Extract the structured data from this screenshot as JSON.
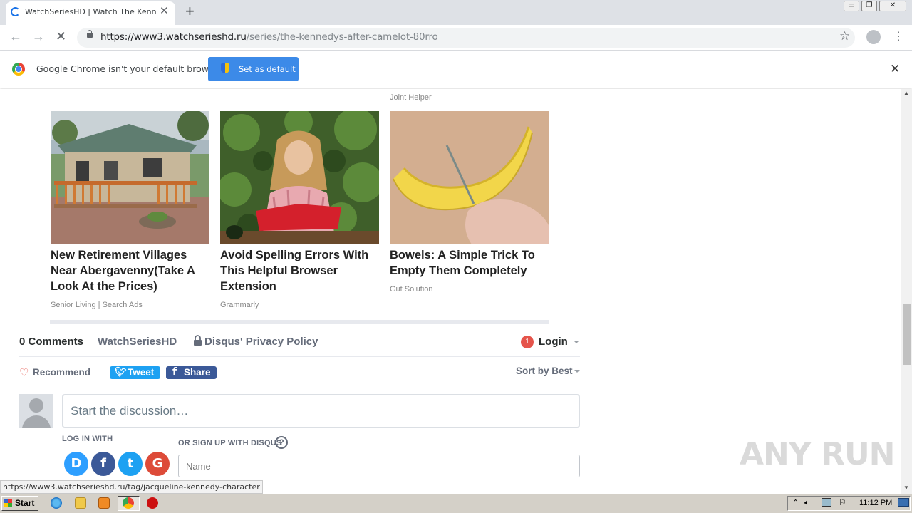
{
  "browser": {
    "tab_title": "WatchSeriesHD | Watch The Kennedys After Camelot",
    "tab_close": "✕",
    "new_tab": "+",
    "url_host": "https://www3.watchserieshd.ru",
    "url_path": "/series/the-kennedys-after-camelot-80rro",
    "window_buttons": [
      "▭",
      "❐",
      "✕"
    ],
    "back": "←",
    "forward": "→",
    "stop": "✕",
    "star": "☆",
    "menu": "⋮"
  },
  "infobar": {
    "message": "Google Chrome isn't your default browser",
    "button": "Set as default",
    "close": "✕"
  },
  "ads": {
    "top_source": "Joint Helper",
    "items": [
      {
        "title": "New Retirement Villages Near Abergavenny(Take A Look At the Prices)",
        "source": "Senior Living | Search Ads",
        "image": "house-photo"
      },
      {
        "title": "Avoid Spelling Errors With This Helpful Browser Extension",
        "source": "Grammarly",
        "image": "woman-reading-photo"
      },
      {
        "title": "Bowels: A Simple Trick To Empty Them Completely",
        "source": "Gut Solution",
        "image": "banana-photo"
      }
    ]
  },
  "disqus": {
    "comments_tab": "0 Comments",
    "community_tab": "WatchSeriesHD",
    "privacy": "Disqus' Privacy Policy",
    "notif_count": "1",
    "login": "Login",
    "recommend": "Recommend",
    "tweet": "Tweet",
    "share": "Share",
    "sort": "Sort by Best",
    "placeholder": "Start the discussion…",
    "log_in_with": "LOG IN WITH",
    "sign_up": "OR SIGN UP WITH DISQUS",
    "help": "?",
    "name_placeholder": "Name",
    "providers": [
      {
        "letter": "D",
        "color": "#2e9fff"
      },
      {
        "letter": "f",
        "color": "#3b5998"
      },
      {
        "letter": "t",
        "color": "#1da1f2"
      },
      {
        "letter": "G",
        "color": "#dd4b39"
      }
    ]
  },
  "status_url": "https://www3.watchserieshd.ru/tag/jacqueline-kennedy-character",
  "watermark": "ANY RUN",
  "taskbar": {
    "start": "Start",
    "clock": "11:12 PM"
  }
}
